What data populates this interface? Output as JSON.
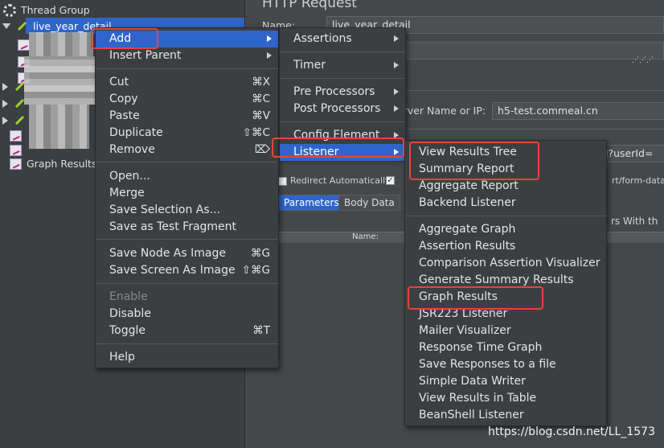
{
  "tree": {
    "root": "Thread Group",
    "selected": "live_year_detail",
    "graph_results": "Graph Results"
  },
  "main": {
    "title": "HTTP Request",
    "name_label": "Name:",
    "name_value": "live_year_detail",
    "server_label": "erver Name or IP:",
    "server_value": "h5-test.commeal.cn",
    "path_fragment": "l?userId=",
    "redirect_label": "Redirect Automatically",
    "content_fragment": "rt/form-data",
    "tab_parameters": "Parameters",
    "tab_body": "Body Data",
    "col_name": "Name:",
    "send_fragment": "rs With th"
  },
  "context_menu": {
    "items": [
      {
        "label": "Add",
        "shortcut": "",
        "submenu": true
      },
      {
        "label": "Insert Parent",
        "shortcut": "",
        "submenu": true
      },
      {
        "label": "Cut",
        "shortcut": "⌘X"
      },
      {
        "label": "Copy",
        "shortcut": "⌘C"
      },
      {
        "label": "Paste",
        "shortcut": "⌘V"
      },
      {
        "label": "Duplicate",
        "shortcut": "⇧⌘C"
      },
      {
        "label": "Remove",
        "shortcut": "⌦"
      },
      {
        "label": "Open...",
        "shortcut": ""
      },
      {
        "label": "Merge",
        "shortcut": ""
      },
      {
        "label": "Save Selection As...",
        "shortcut": ""
      },
      {
        "label": "Save as Test Fragment",
        "shortcut": ""
      },
      {
        "label": "Save Node As Image",
        "shortcut": "⌘G"
      },
      {
        "label": "Save Screen As Image",
        "shortcut": "⇧⌘G"
      },
      {
        "label": "Enable",
        "shortcut": ""
      },
      {
        "label": "Disable",
        "shortcut": ""
      },
      {
        "label": "Toggle",
        "shortcut": "⌘T"
      },
      {
        "label": "Help",
        "shortcut": ""
      }
    ]
  },
  "add_menu": {
    "items": [
      "Assertions",
      "Timer",
      "Pre Processors",
      "Post Processors",
      "Config Element",
      "Listener"
    ]
  },
  "listener_menu": {
    "items": [
      "View Results Tree",
      "Summary Report",
      "Aggregate Report",
      "Backend Listener",
      "Aggregate Graph",
      "Assertion Results",
      "Comparison Assertion Visualizer",
      "Generate Summary Results",
      "Graph Results",
      "JSR223 Listener",
      "Mailer Visualizer",
      "Response Time Graph",
      "Save Responses to a file",
      "Simple Data Writer",
      "View Results in Table",
      "BeanShell Listener"
    ]
  },
  "watermark": "https://blog.csdn.net/LL_1573",
  "colors": {
    "selection": "#2f65ca",
    "highlight_box": "#e5443a",
    "panel": "#3c3f41"
  }
}
